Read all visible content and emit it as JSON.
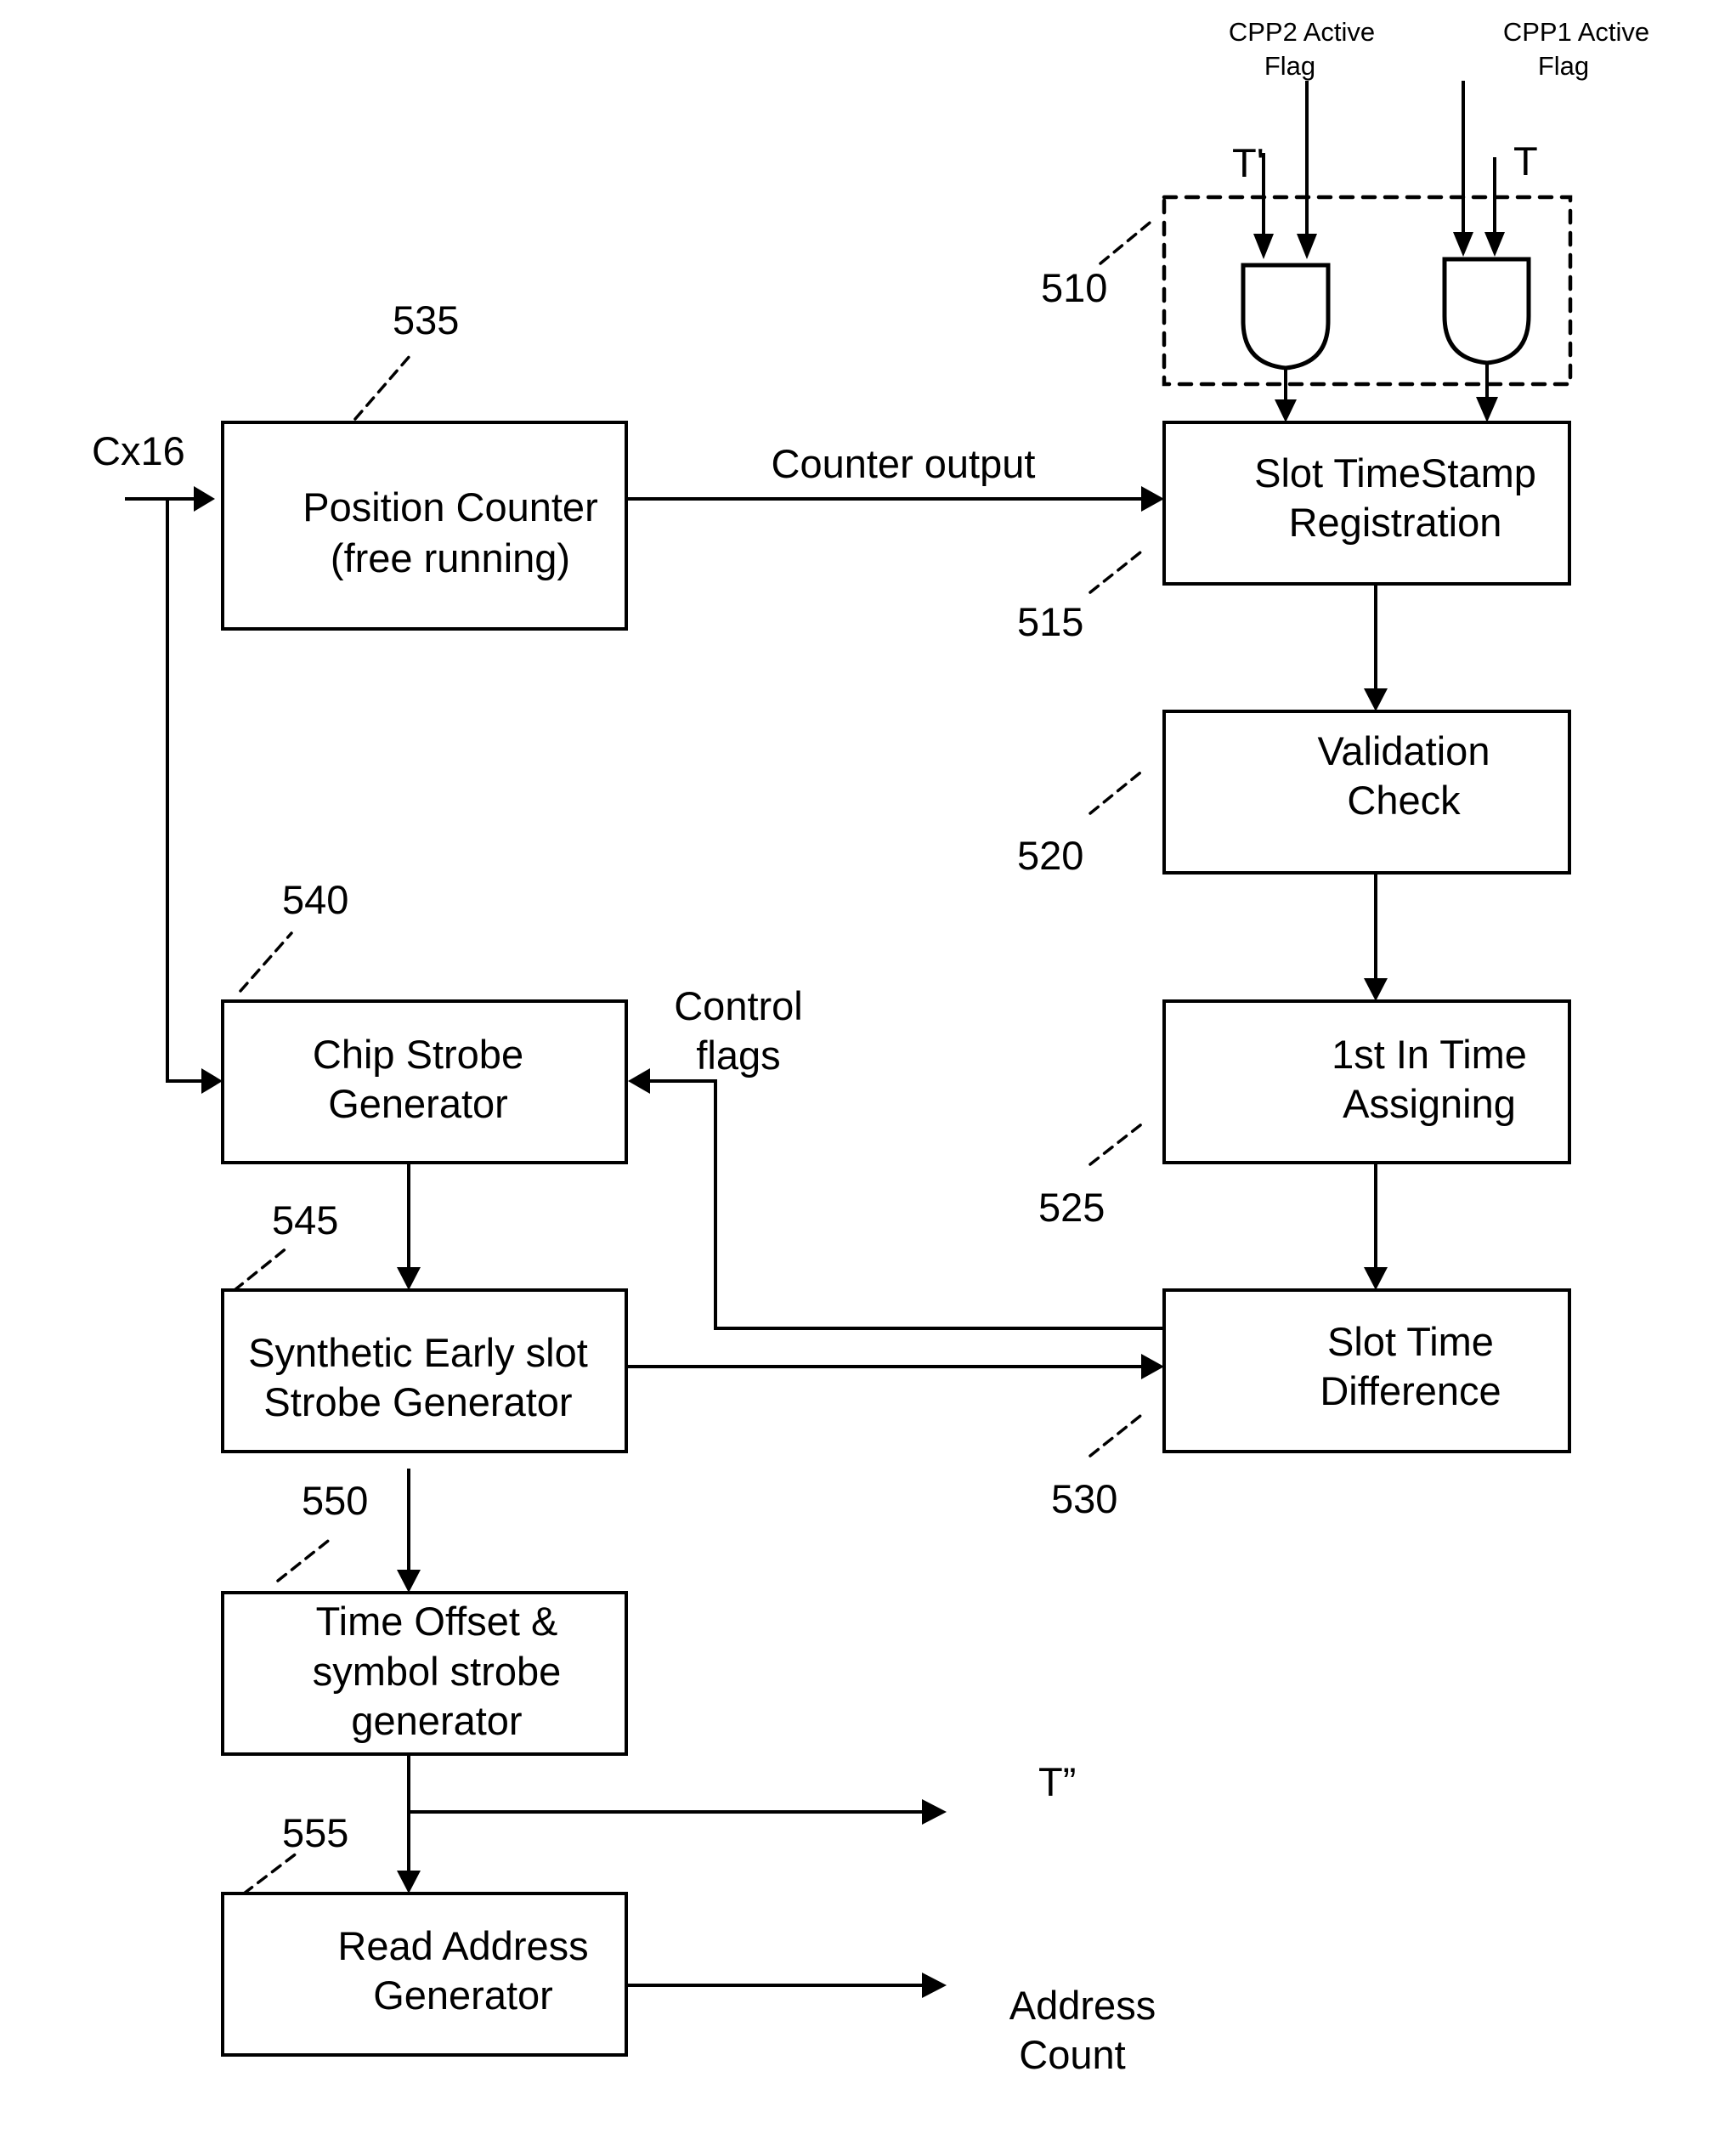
{
  "figure": {
    "blocks": [
      {
        "id": "position-counter",
        "ref": "535",
        "lines": [
          "Position Counter",
          "(free running)"
        ]
      },
      {
        "id": "slot-timestamp-registration",
        "ref": "515",
        "lines": [
          "Slot TimeStamp",
          "Registration"
        ]
      },
      {
        "id": "validation-check",
        "ref": "520",
        "lines": [
          "Validation",
          "Check"
        ]
      },
      {
        "id": "first-in-time-assigning",
        "ref": "525",
        "lines": [
          "1st In Time",
          "Assigning"
        ]
      },
      {
        "id": "slot-time-difference",
        "ref": "530",
        "lines": [
          "Slot Time",
          "Difference"
        ]
      },
      {
        "id": "chip-strobe-generator",
        "ref": "540",
        "lines": [
          "Chip Strobe",
          "Generator"
        ]
      },
      {
        "id": "synthetic-early-slot-strobe-generator",
        "ref": "545",
        "lines": [
          "Synthetic Early slot",
          "Strobe Generator"
        ]
      },
      {
        "id": "time-offset-symbol-strobe-generator",
        "ref": "550",
        "lines": [
          "Time Offset &",
          "symbol strobe",
          "generator"
        ]
      },
      {
        "id": "read-address-generator",
        "ref": "555",
        "lines": [
          "Read Address",
          "Generator"
        ]
      }
    ],
    "gate_group": {
      "ref": "510",
      "gates": [
        "and-gate-cpp2",
        "and-gate-cpp1"
      ]
    },
    "signals": {
      "cx16": "Cx16",
      "counter_output": "Counter output",
      "control_flags": [
        "Control",
        "flags"
      ],
      "cpp2_active_flag": [
        "CPP2 Active",
        "Flag"
      ],
      "cpp1_active_flag": [
        "CPP1 Active",
        "Flag"
      ],
      "t_prime": "T'",
      "t": "T",
      "t_double_prime": "T”",
      "address_count": [
        "Address",
        "Count"
      ]
    }
  }
}
